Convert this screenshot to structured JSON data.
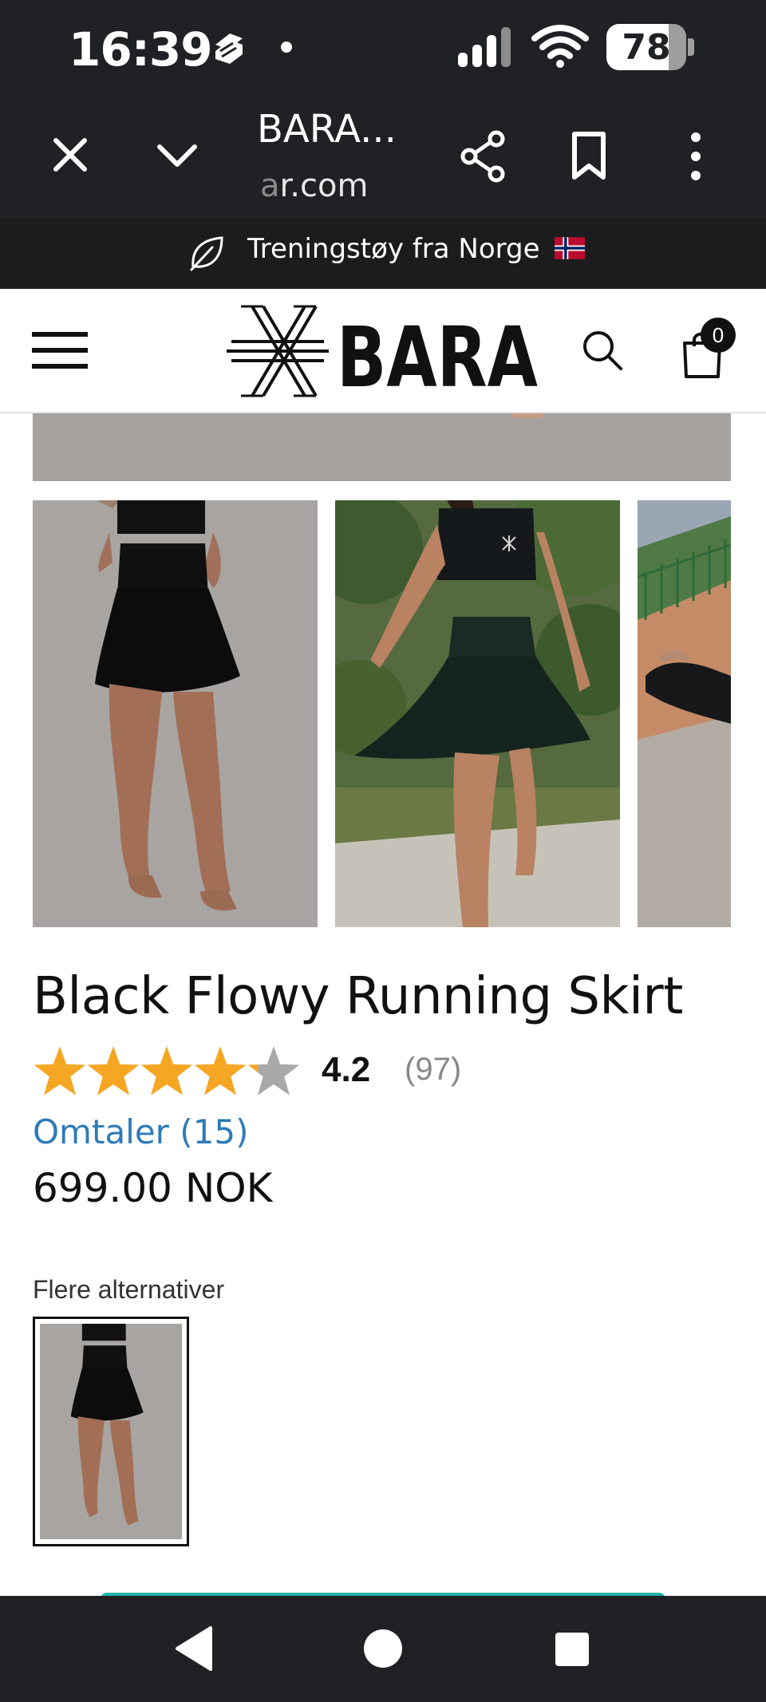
{
  "status_bar": {
    "time": "16:39",
    "battery_percent": "78",
    "battery_level": 0.78,
    "icons": [
      "app-notification-icon",
      "notification-dot-icon",
      "signal-icon",
      "wifi-icon",
      "battery-icon"
    ]
  },
  "browser_toolbar": {
    "page_title": "BARA...",
    "url_faded": "a",
    "url_text": "r.com",
    "icons": [
      "close-icon",
      "chevron-down-icon",
      "share-icon",
      "bookmark-icon",
      "more-vert-icon"
    ]
  },
  "promo_banner": {
    "text": "Treningstøy fra Norge",
    "icons": [
      "leaf-icon",
      "norway-flag-icon"
    ]
  },
  "site_header": {
    "logo_text": "BARA",
    "cart_count": "0",
    "icons": [
      "menu-icon",
      "bara-logo",
      "search-icon",
      "shopping-bag-icon"
    ]
  },
  "product": {
    "title": "Black Flowy Running Skirt",
    "rating_value": "4.2",
    "rating_count": "(97)",
    "rating_stars": 4.2,
    "reviews_link": "Omtaler (15)",
    "price": "699.00 NOK"
  },
  "alternatives": {
    "label": "Flere alternativer"
  },
  "colors": {
    "system_dark": "#202124",
    "link_blue": "#2f7ab8",
    "star_gold": "#f5a623",
    "star_grey": "#a9a9a9",
    "cta_teal": "#1fb3a4"
  },
  "nav_bar": {
    "icons": [
      "back-icon",
      "home-icon",
      "recents-icon"
    ]
  }
}
